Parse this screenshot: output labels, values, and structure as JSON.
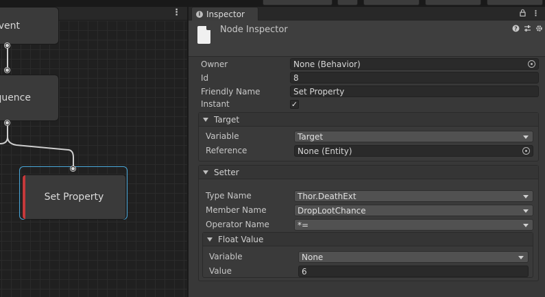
{
  "graph": {
    "menu_icon": "kebab-menu-icon",
    "nodes": {
      "event_label": "vent",
      "sequence_label": "quence",
      "set_property_label": "Set Property"
    }
  },
  "inspector": {
    "tab_label": "Inspector",
    "tab_icon": "info-icon",
    "lock_icon": "lock-icon",
    "menu_icon": "kebab-menu-icon",
    "title": "Node Inspector",
    "header_icons": [
      "help-icon",
      "preset-icon",
      "settings-icon"
    ],
    "fields": {
      "owner": {
        "label": "Owner",
        "value": "None (Behavior)"
      },
      "id": {
        "label": "Id",
        "value": "8"
      },
      "friendly_name": {
        "label": "Friendly Name",
        "value": "Set Property"
      },
      "instant": {
        "label": "Instant",
        "checked": true,
        "check_glyph": "✓"
      }
    },
    "target": {
      "header": "Target",
      "variable": {
        "label": "Variable",
        "value": "Target"
      },
      "reference": {
        "label": "Reference",
        "value": "None (Entity)"
      }
    },
    "setter": {
      "header": "Setter",
      "type_name": {
        "label": "Type Name",
        "value": "Thor.DeathExt"
      },
      "member_name": {
        "label": "Member Name",
        "value": "DropLootChance"
      },
      "operator_name": {
        "label": "Operator Name",
        "value": "*="
      },
      "float_value": {
        "header": "Float Value",
        "variable": {
          "label": "Variable",
          "value": "None"
        },
        "value": {
          "label": "Value",
          "value": "6"
        }
      }
    }
  },
  "colors": {
    "selection_outline": "#4aa9dc",
    "node_accent": "#c6393b",
    "panel_bg": "#383838",
    "graph_bg": "#202020"
  }
}
